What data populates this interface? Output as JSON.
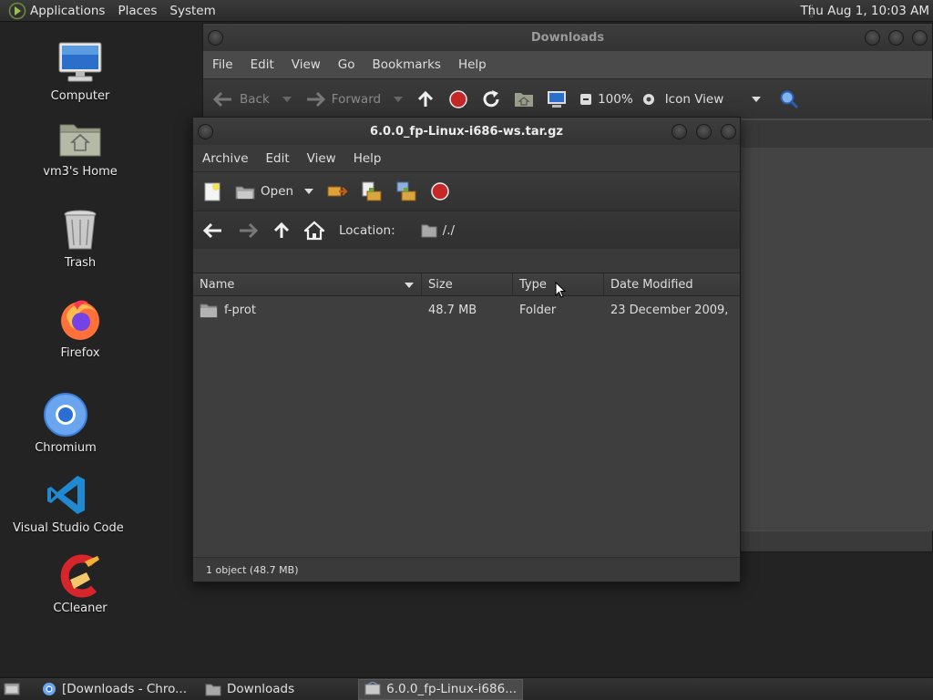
{
  "top_panel": {
    "menus": [
      "Applications",
      "Places",
      "System"
    ],
    "clock": "Thu Aug  1, 10:03 AM"
  },
  "desktop_icons": [
    {
      "label": "Computer",
      "icon": "computer-icon"
    },
    {
      "label": "vm3's Home",
      "icon": "home-folder-icon"
    },
    {
      "label": "Trash",
      "icon": "trash-icon"
    },
    {
      "label": "Firefox",
      "icon": "firefox-icon"
    },
    {
      "label": "Chromium",
      "icon": "chromium-icon"
    },
    {
      "label": "Visual Studio Code",
      "icon": "vscode-icon"
    },
    {
      "label": "CCleaner",
      "icon": "ccleaner-icon"
    }
  ],
  "downloads_window": {
    "title": "Downloads",
    "menus": [
      "File",
      "Edit",
      "View",
      "Go",
      "Bookmarks",
      "Help"
    ],
    "toolbar": {
      "back": "Back",
      "forward": "Forward",
      "zoom": "100%",
      "view_mode": "Icon View"
    }
  },
  "archive_window": {
    "title": "6.0.0_fp-Linux-i686-ws.tar.gz",
    "menus": [
      "Archive",
      "Edit",
      "View",
      "Help"
    ],
    "toolbar": {
      "open": "Open"
    },
    "location_label": "Location:",
    "location_value": "/./",
    "columns": [
      "Name",
      "Size",
      "Type",
      "Date Modified"
    ],
    "rows": [
      {
        "name": "f-prot",
        "size": "48.7 MB",
        "type": "Folder",
        "date": "23 December 2009, ..."
      }
    ],
    "status": "1 object (48.7 MB)"
  },
  "taskbar": {
    "tasks": [
      "[Downloads - Chro...",
      "Downloads",
      "6.0.0_fp-Linux-i686..."
    ]
  },
  "colors": {
    "desktop_bg": "#232323",
    "stop_red": "#c62828",
    "window_bg": "#3c3c3c"
  }
}
